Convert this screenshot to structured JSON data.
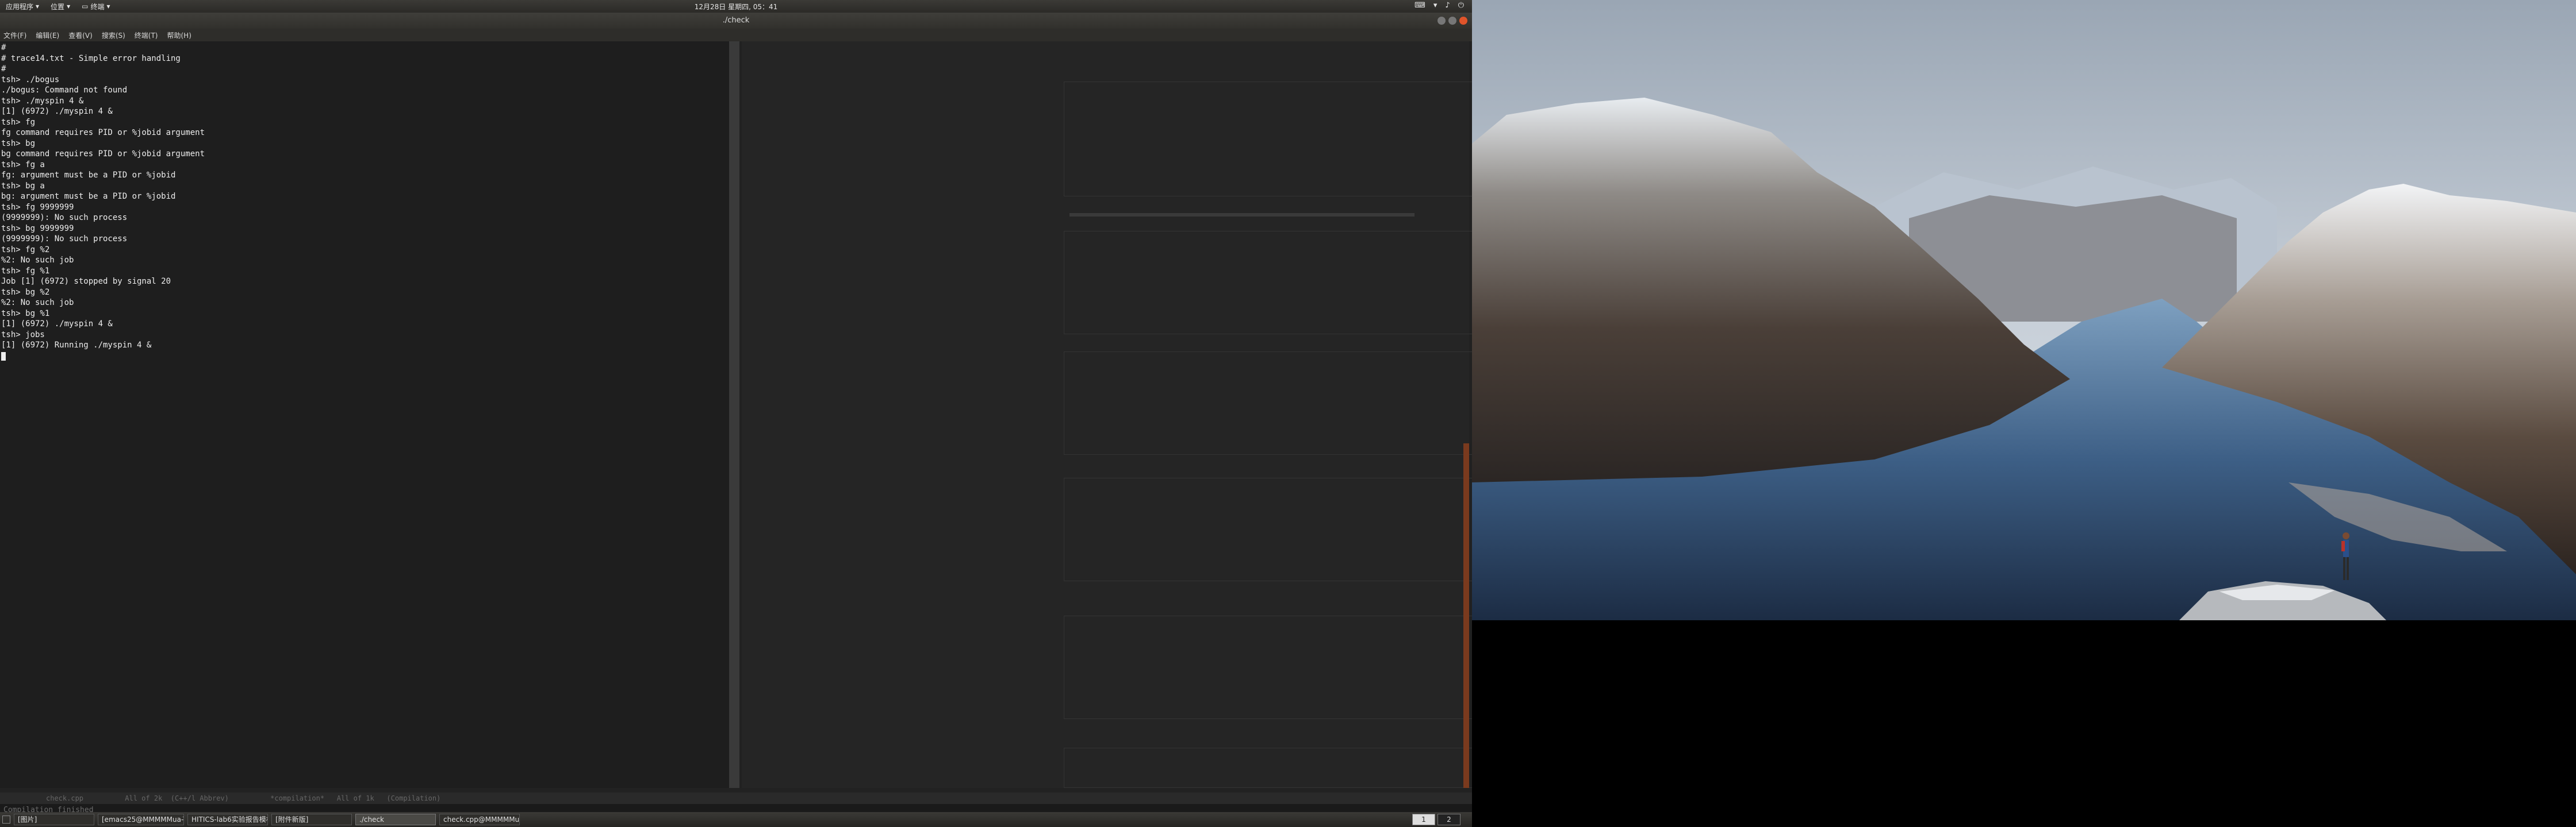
{
  "top_panel": {
    "menus": [
      "应用程序",
      "位置",
      "终端"
    ],
    "clock": "12月28日 星期四, 05：41"
  },
  "window": {
    "title": "./check",
    "menubar": [
      "文件(F)",
      "编辑(E)",
      "查看(V)",
      "搜索(S)",
      "终端(T)",
      "帮助(H)"
    ]
  },
  "terminal": {
    "lines": [
      "#",
      "# trace14.txt - Simple error handling",
      "#",
      "tsh> ./bogus",
      "./bogus: Command not found",
      "tsh> ./myspin 4 &",
      "[1] (6972) ./myspin 4 &",
      "tsh> fg",
      "fg command requires PID or %jobid argument",
      "tsh> bg",
      "bg command requires PID or %jobid argument",
      "tsh> fg a",
      "fg: argument must be a PID or %jobid",
      "tsh> bg a",
      "bg: argument must be a PID or %jobid",
      "tsh> fg 9999999",
      "(9999999): No such process",
      "tsh> bg 9999999",
      "(9999999): No such process",
      "tsh> fg %2",
      "%2: No such job",
      "tsh> fg %1",
      "Job [1] (6972) stopped by signal 20",
      "tsh> bg %2",
      "%2: No such job",
      "tsh> bg %1",
      "[1] (6972) ./myspin 4 &",
      "tsh> jobs",
      "[1] (6972) Running ./myspin 4 &"
    ]
  },
  "status": {
    "modeline": "check.cpp          All of 2k  (C++/l Abbrev)          *compilation*   All of 1k   (Compilation)",
    "echo": "Compilation finished"
  },
  "taskbar": {
    "tasks": [
      "[图片]",
      "[emacs25@MMMMMua-T]",
      "HITICS-lab6实验报告模板 2017...",
      "[附件新版]",
      "./check",
      "check.cpp@MMMMMua"
    ],
    "workspaces": [
      "1",
      "2"
    ]
  },
  "colors": {
    "terminal_bg": "#212121",
    "terminal_fg": "#ededed",
    "panel_bg": "#2b2a27",
    "accent_scroll": "#7a3a1e"
  }
}
